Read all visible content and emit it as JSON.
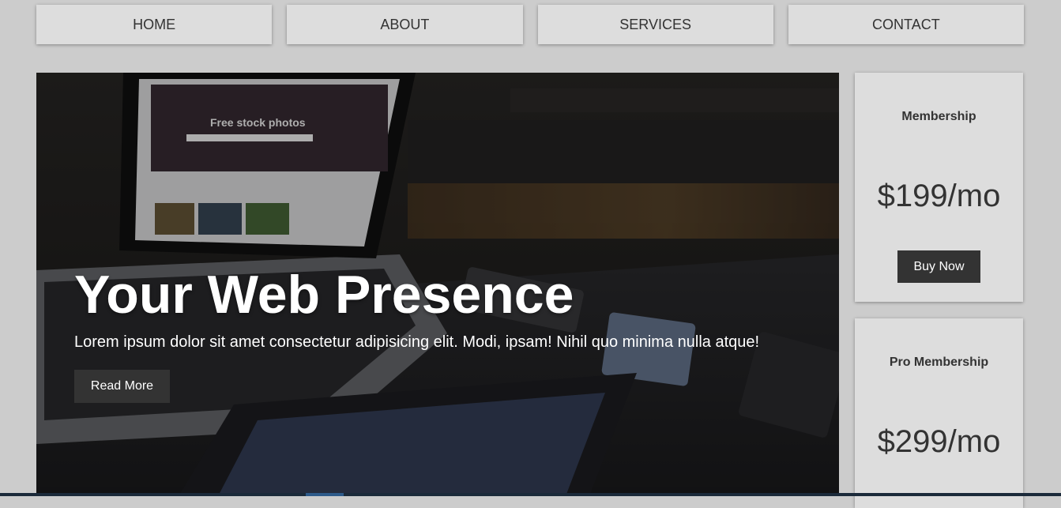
{
  "nav": {
    "items": [
      {
        "label": "HOME"
      },
      {
        "label": "ABOUT"
      },
      {
        "label": "SERVICES"
      },
      {
        "label": "CONTACT"
      }
    ]
  },
  "hero": {
    "title": "Your Web Presence",
    "text": "Lorem ipsum dolor sit amet consectetur adipisicing elit. Modi, ipsam! Nihil quo minima nulla atque!",
    "button_label": "Read More",
    "image_screen_heading": "Free stock photos"
  },
  "pricing": [
    {
      "title": "Membership",
      "price": "$199/mo",
      "button_label": "Buy Now"
    },
    {
      "title": "Pro Membership",
      "price": "$299/mo"
    }
  ],
  "colors": {
    "page_bg": "#cccccc",
    "panel_bg": "#dddddd",
    "button_bg": "#333333",
    "text": "#333333"
  }
}
